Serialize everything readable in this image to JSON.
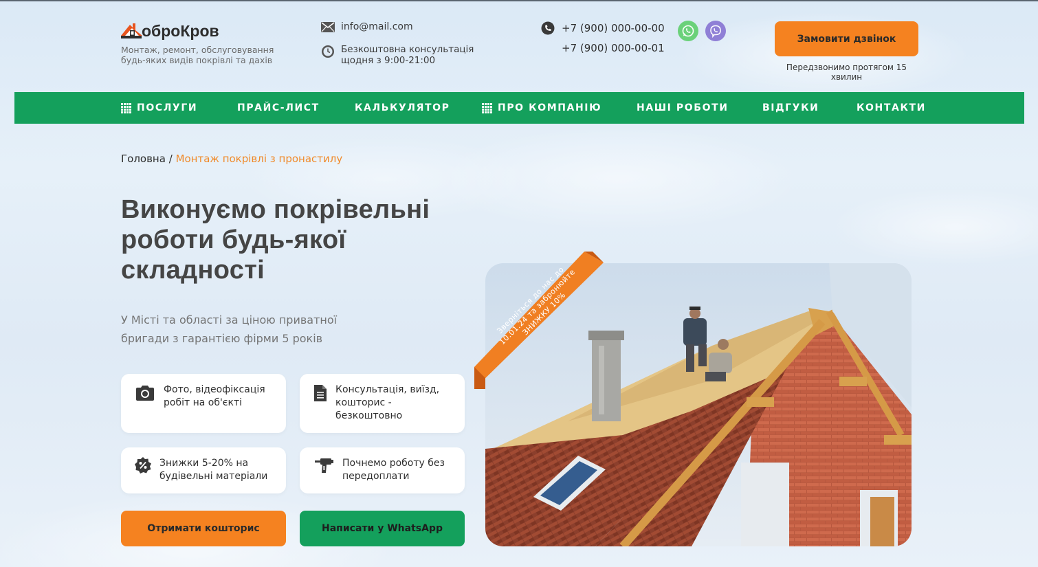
{
  "header": {
    "logo": {
      "text": "оброКров",
      "tagline": "Монтаж, ремонт, обслуговування будь-яких видів покрівлі та дахів"
    },
    "email": "info@mail.com",
    "consult": {
      "line1": "Безкоштовна консультація",
      "line2": "щодня з 9:00-21:00"
    },
    "phones": [
      "+7 (900) 000-00-00",
      "+7 (900) 000-00-01"
    ],
    "messengers": [
      {
        "name": "whatsapp",
        "icon": "whatsapp-icon",
        "color": "#6bd17a"
      },
      {
        "name": "viber",
        "icon": "viber-icon",
        "color": "#8f7fd6"
      }
    ],
    "call_button": "Замовити дзвінок",
    "call_note": "Передзвонимо протягом 15 хвилин"
  },
  "nav": {
    "items": [
      {
        "label": "ПОСЛУГИ",
        "has_grid_icon": true
      },
      {
        "label": "ПРАЙС-ЛИСТ",
        "has_grid_icon": false
      },
      {
        "label": "КАЛЬКУЛЯТОР",
        "has_grid_icon": false
      },
      {
        "label": "ПРО КОМПАНІЮ",
        "has_grid_icon": true
      },
      {
        "label": "НАШІ РОБОТИ",
        "has_grid_icon": false
      },
      {
        "label": "ВІДГУКИ",
        "has_grid_icon": false
      },
      {
        "label": "КОНТАКТИ",
        "has_grid_icon": false
      }
    ]
  },
  "breadcrumb": {
    "home": "Головна",
    "separator": "/",
    "current": "Монтаж покрівлі з пронастилу"
  },
  "hero": {
    "title": "Виконуємо покрівельні роботи будь-якої складності",
    "lead": "У Місті та області за ціною приватної бригади з гарантією фірми 5 років",
    "features": [
      {
        "icon": "camera-icon",
        "text": "Фото, відеофіксація робіт на об'єкті"
      },
      {
        "icon": "document-icon",
        "text": "Консультація, виїзд, кошторис - безкоштовно"
      },
      {
        "icon": "discount-icon",
        "text": "Знижки 5-20% на будівельні матеріали"
      },
      {
        "icon": "drill-icon",
        "text": "Почнемо роботу без передоплати"
      }
    ],
    "buttons": {
      "estimate": "Отримати кошторис",
      "whatsapp": "Написати у WhatsApp"
    },
    "ribbon": {
      "line1": "Зверніться до нас до",
      "line2": "10.01.24 та забронюйте",
      "line3": "ЗНИЖКУ 10%"
    }
  },
  "colors": {
    "accent": "#f58220",
    "brand_green": "#14a05c",
    "text_dark": "#454545"
  }
}
